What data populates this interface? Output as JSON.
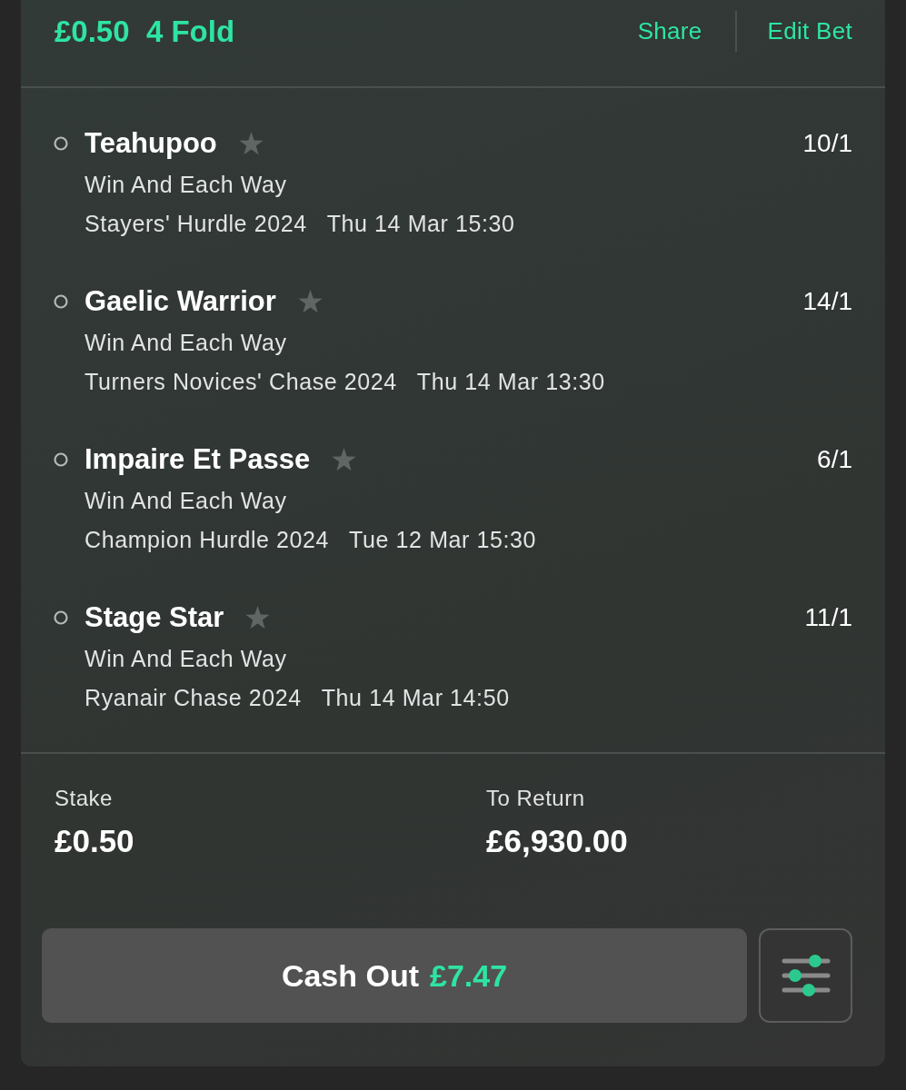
{
  "header": {
    "stake": "£0.50",
    "bet_type": "4 Fold",
    "actions": [
      "Share",
      "Edit Bet"
    ]
  },
  "legs": [
    {
      "selection": "Teahupoo",
      "odds": "10/1",
      "market": "Win And Each Way",
      "event": "Stayers' Hurdle 2024",
      "time": "Thu 14 Mar 15:30"
    },
    {
      "selection": "Gaelic Warrior",
      "odds": "14/1",
      "market": "Win And Each Way",
      "event": "Turners Novices' Chase 2024",
      "time": "Thu 14 Mar 13:30"
    },
    {
      "selection": "Impaire Et Passe",
      "odds": "6/1",
      "market": "Win And Each Way",
      "event": "Champion Hurdle 2024",
      "time": "Tue 12 Mar 15:30"
    },
    {
      "selection": "Stage Star",
      "odds": "11/1",
      "market": "Win And Each Way",
      "event": "Ryanair Chase 2024",
      "time": "Thu 14 Mar 14:50"
    }
  ],
  "summary": {
    "stake_label": "Stake",
    "stake": "£0.50",
    "return_label": "To Return",
    "return": "£6,930.00"
  },
  "cash_out": {
    "label": "Cash Out",
    "amount": "£7.47"
  }
}
